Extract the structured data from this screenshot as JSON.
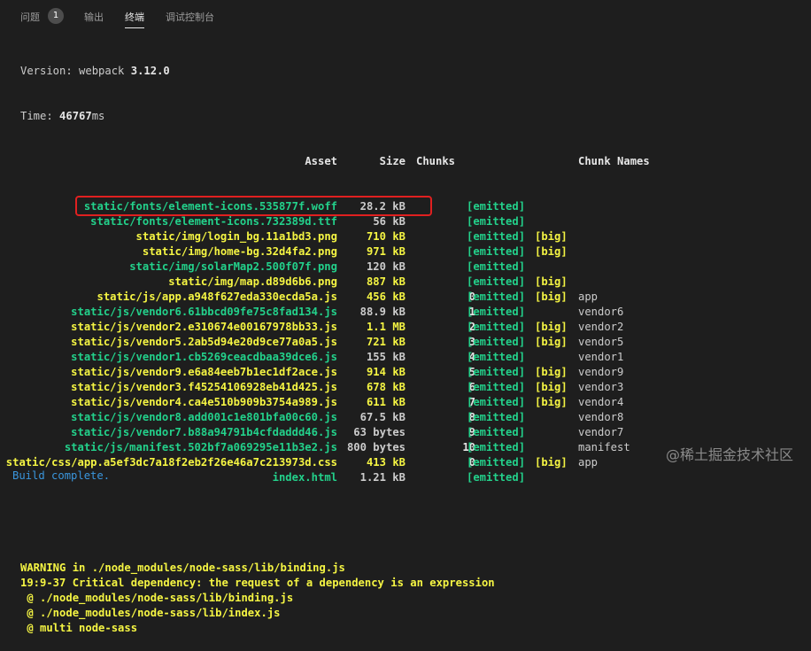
{
  "tabs": [
    {
      "label": "问题",
      "badge": "1"
    },
    {
      "label": "输出"
    },
    {
      "label": "终端",
      "active": true
    },
    {
      "label": "调试控制台"
    }
  ],
  "terminal": {
    "version_prefix": "Version: webpack ",
    "version": "3.12.0",
    "time_prefix": "Time: ",
    "time_value": "46767",
    "time_unit": "ms",
    "headers": {
      "asset": "Asset",
      "size": "Size",
      "chunks": "Chunks",
      "chunk_names": "Chunk Names"
    },
    "rows": [
      {
        "asset": "static/fonts/element-icons.535877f.woff",
        "size": "28.2 kB",
        "chunk": "",
        "emitted": "[emitted]",
        "big": "",
        "name": "",
        "color": "green"
      },
      {
        "asset": "static/fonts/element-icons.732389d.ttf",
        "size": "56 kB",
        "chunk": "",
        "emitted": "[emitted]",
        "big": "",
        "name": "",
        "color": "green"
      },
      {
        "asset": "static/img/login_bg.11a1bd3.png",
        "size": "710 kB",
        "chunk": "",
        "emitted": "[emitted]",
        "big": "[big]",
        "name": "",
        "color": "yellow"
      },
      {
        "asset": "static/img/home-bg.32d4fa2.png",
        "size": "971 kB",
        "chunk": "",
        "emitted": "[emitted]",
        "big": "[big]",
        "name": "",
        "color": "yellow"
      },
      {
        "asset": "static/img/solarMap2.500f07f.png",
        "size": "120 kB",
        "chunk": "",
        "emitted": "[emitted]",
        "big": "",
        "name": "",
        "color": "green"
      },
      {
        "asset": "static/img/map.d89d6b6.png",
        "size": "887 kB",
        "chunk": "",
        "emitted": "[emitted]",
        "big": "[big]",
        "name": "",
        "color": "yellow"
      },
      {
        "asset": "static/js/app.a948f627eda330ecda5a.js",
        "size": "456 kB",
        "chunk": "0",
        "emitted": "[emitted]",
        "big": "[big]",
        "name": "app",
        "color": "yellow"
      },
      {
        "asset": "static/js/vendor6.61bbcd09fe75c8fad134.js",
        "size": "88.9 kB",
        "chunk": "1",
        "emitted": "[emitted]",
        "big": "",
        "name": "vendor6",
        "color": "green"
      },
      {
        "asset": "static/js/vendor2.e310674e00167978bb33.js",
        "size": "1.1 MB",
        "chunk": "2",
        "emitted": "[emitted]",
        "big": "[big]",
        "name": "vendor2",
        "color": "yellow"
      },
      {
        "asset": "static/js/vendor5.2ab5d94e20d9ce77a0a5.js",
        "size": "721 kB",
        "chunk": "3",
        "emitted": "[emitted]",
        "big": "[big]",
        "name": "vendor5",
        "color": "yellow"
      },
      {
        "asset": "static/js/vendor1.cb5269ceacdbaa39dce6.js",
        "size": "155 kB",
        "chunk": "4",
        "emitted": "[emitted]",
        "big": "",
        "name": "vendor1",
        "color": "green"
      },
      {
        "asset": "static/js/vendor9.e6a84eeb7b1ec1df2ace.js",
        "size": "914 kB",
        "chunk": "5",
        "emitted": "[emitted]",
        "big": "[big]",
        "name": "vendor9",
        "color": "yellow"
      },
      {
        "asset": "static/js/vendor3.f45254106928eb41d425.js",
        "size": "678 kB",
        "chunk": "6",
        "emitted": "[emitted]",
        "big": "[big]",
        "name": "vendor3",
        "color": "yellow"
      },
      {
        "asset": "static/js/vendor4.ca4e510b909b3754a989.js",
        "size": "611 kB",
        "chunk": "7",
        "emitted": "[emitted]",
        "big": "[big]",
        "name": "vendor4",
        "color": "yellow"
      },
      {
        "asset": "static/js/vendor8.add001c1e801bfa00c60.js",
        "size": "67.5 kB",
        "chunk": "8",
        "emitted": "[emitted]",
        "big": "",
        "name": "vendor8",
        "color": "green"
      },
      {
        "asset": "static/js/vendor7.b88a94791b4cfdaddd46.js",
        "size": "63 bytes",
        "chunk": "9",
        "emitted": "[emitted]",
        "big": "",
        "name": "vendor7",
        "color": "green"
      },
      {
        "asset": "static/js/manifest.502bf7a069295e11b3e2.js",
        "size": "800 bytes",
        "chunk": "10",
        "emitted": "[emitted]",
        "big": "",
        "name": "manifest",
        "color": "green"
      },
      {
        "asset": "static/css/app.a5ef3dc7a18f2eb2f26e46a7c213973d.css",
        "size": "413 kB",
        "chunk": "0",
        "emitted": "[emitted]",
        "big": "[big]",
        "name": "app",
        "color": "yellow"
      },
      {
        "asset": "index.html",
        "size": "1.21 kB",
        "chunk": "",
        "emitted": "[emitted]",
        "big": "",
        "name": "",
        "color": "green"
      }
    ],
    "warning_lines": [
      "WARNING in ./node_modules/node-sass/lib/binding.js",
      "19:9-37 Critical dependency: the request of a dependency is an expression",
      " @ ./node_modules/node-sass/lib/binding.js",
      " @ ./node_modules/node-sass/lib/index.js",
      " @ multi node-sass"
    ],
    "build_line": "Build complete."
  },
  "watermark": "@稀土掘金技术社区",
  "colors": {
    "background": "#1e1e1e",
    "green": "#23d18b",
    "yellow": "#f5f543",
    "highlight": "#e02020"
  }
}
